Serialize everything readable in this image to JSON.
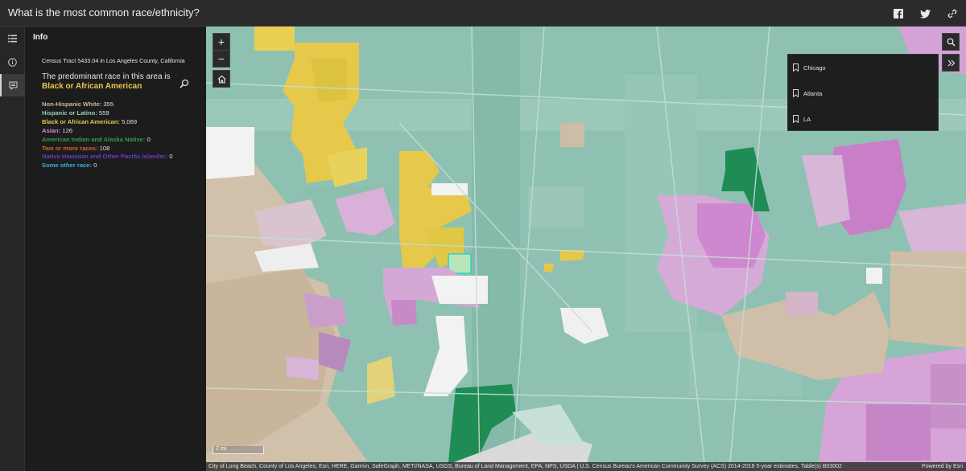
{
  "app": {
    "title": "What is the most common race/ethnicity?"
  },
  "header_icons": [
    "facebook-icon",
    "twitter-icon",
    "link-icon"
  ],
  "rail": {
    "items": [
      {
        "icon": "list-icon",
        "active": false
      },
      {
        "icon": "info-icon",
        "active": false
      },
      {
        "icon": "popup-icon",
        "active": true
      }
    ]
  },
  "panel": {
    "title": "Info",
    "tract": "Census Tract 5433.04 in Los Angeles County, California",
    "predominant_prefix": "The predominant race in this area is",
    "predominant_value": "Black or African American",
    "predominant_color": "#e6c84a",
    "counts": [
      {
        "label": "Non-Hispanic White:",
        "value": "355",
        "color": "#c8b89b"
      },
      {
        "label": "Hispanic or Latino:",
        "value": "559",
        "color": "#9ecbb9"
      },
      {
        "label": "Black or African American:",
        "value": "5,069",
        "color": "#e6c84a"
      },
      {
        "label": "Asian:",
        "value": "126",
        "color": "#d08ad6"
      },
      {
        "label": "American Indian and Alaska Native:",
        "value": "0",
        "color": "#2f9a5a"
      },
      {
        "label": "Two or more races:",
        "value": "108",
        "color": "#d9622f"
      },
      {
        "label": "Native Hawaiian and Other Pacific Islander:",
        "value": "0",
        "color": "#6a3cc7"
      },
      {
        "label": "Some other race:",
        "value": "0",
        "color": "#3ab0d9"
      }
    ]
  },
  "map": {
    "zoom_in": "+",
    "zoom_out": "−",
    "bookmarks": [
      "Chicago",
      "Atlanta",
      "LA"
    ],
    "scale": "2 mi",
    "attribution": "City of Long Beach, County of Los Angeles, Esri, HERE, Garmin, SafeGraph, METI/NASA, USGS, Bureau of Land Management, EPA, NPS, USDA | U.S. Census Bureau's American Community Survey (ACS) 2014-2018 5-year estimates, Table(s) B03002",
    "powered_by": "Powered by Esri"
  }
}
